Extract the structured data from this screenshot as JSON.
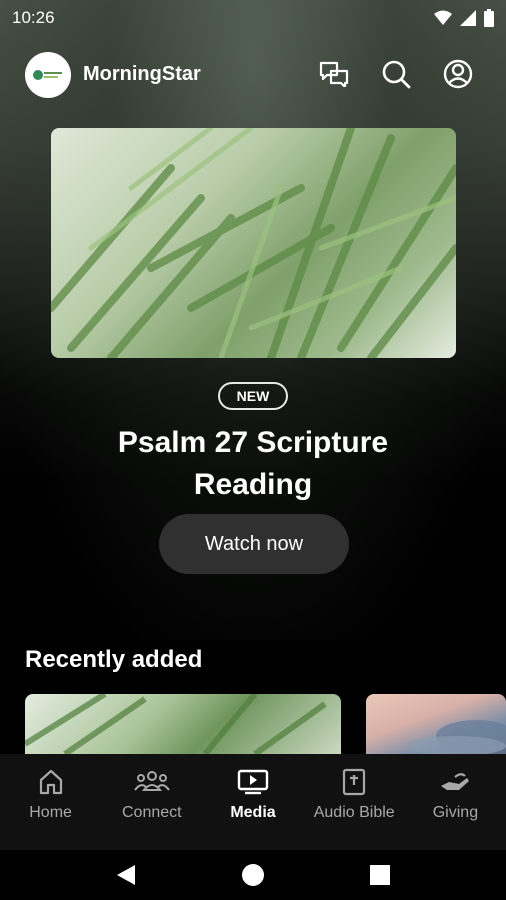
{
  "status_bar": {
    "time": "10:26"
  },
  "header": {
    "app_name": "MorningStar"
  },
  "hero": {
    "badge": "NEW",
    "title": "Psalm 27 Scripture Reading",
    "button_label": "Watch now"
  },
  "recent": {
    "title": "Recently added"
  },
  "tabs": [
    {
      "label": "Home",
      "icon": "home-icon"
    },
    {
      "label": "Connect",
      "icon": "people-icon"
    },
    {
      "label": "Media",
      "icon": "media-icon",
      "active": true
    },
    {
      "label": "Audio Bible",
      "icon": "bible-icon"
    },
    {
      "label": "Giving",
      "icon": "giving-icon"
    }
  ]
}
